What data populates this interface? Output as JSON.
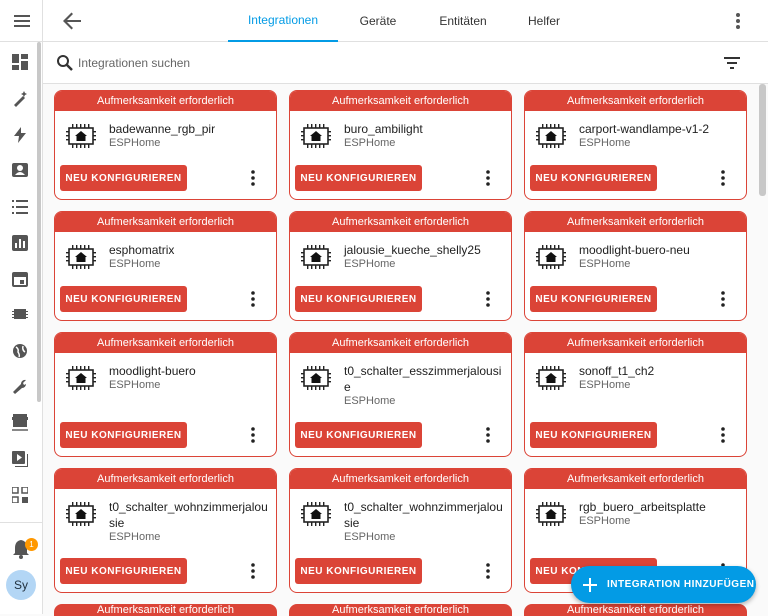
{
  "topbar": {
    "tabs": [
      "Integrationen",
      "Geräte",
      "Entitäten",
      "Helfer"
    ],
    "active_tab": "Integrationen"
  },
  "search": {
    "placeholder": "Integrationen suchen"
  },
  "notifications": {
    "count": "1"
  },
  "user": {
    "initials": "Sy"
  },
  "cards": [
    {
      "header": "Aufmerksamkeit erforderlich",
      "title": "badewanne_rgb_pir",
      "subtitle": "ESPHome",
      "button": "NEU KONFIGURIEREN"
    },
    {
      "header": "Aufmerksamkeit erforderlich",
      "title": "buro_ambilight",
      "subtitle": "ESPHome",
      "button": "NEU KONFIGURIEREN"
    },
    {
      "header": "Aufmerksamkeit erforderlich",
      "title": "carport-wandlampe-v1-2",
      "subtitle": "ESPHome",
      "button": "NEU KONFIGURIEREN"
    },
    {
      "header": "Aufmerksamkeit erforderlich",
      "title": "esphomatrix",
      "subtitle": "ESPHome",
      "button": "NEU KONFIGURIEREN"
    },
    {
      "header": "Aufmerksamkeit erforderlich",
      "title": "jalousie_kueche_shelly25",
      "subtitle": "ESPHome",
      "button": "NEU KONFIGURIEREN"
    },
    {
      "header": "Aufmerksamkeit erforderlich",
      "title": "moodlight-buero-neu",
      "subtitle": "ESPHome",
      "button": "NEU KONFIGURIEREN"
    },
    {
      "header": "Aufmerksamkeit erforderlich",
      "title": "moodlight-buero",
      "subtitle": "ESPHome",
      "button": "NEU KONFIGURIEREN"
    },
    {
      "header": "Aufmerksamkeit erforderlich",
      "title": "t0_schalter_esszimmerjalousie",
      "subtitle": "ESPHome",
      "button": "NEU KONFIGURIEREN"
    },
    {
      "header": "Aufmerksamkeit erforderlich",
      "title": "sonoff_t1_ch2",
      "subtitle": "ESPHome",
      "button": "NEU KONFIGURIEREN"
    },
    {
      "header": "Aufmerksamkeit erforderlich",
      "title": "t0_schalter_wohnzimmerjalousie",
      "subtitle": "ESPHome",
      "button": "NEU KONFIGURIEREN"
    },
    {
      "header": "Aufmerksamkeit erforderlich",
      "title": "t0_schalter_wohnzimmerjalousie",
      "subtitle": "ESPHome",
      "button": "NEU KONFIGURIEREN"
    },
    {
      "header": "Aufmerksamkeit erforderlich",
      "title": "rgb_buero_arbeitsplatte",
      "subtitle": "ESPHome",
      "button": "NEU KONFIGURIEREN"
    }
  ],
  "peek_header": "Aufmerksamkeit erforderlich",
  "fab": {
    "label": "INTEGRATION HINZUFÜGEN"
  },
  "colors": {
    "accent": "#039be5",
    "error": "#db4437",
    "badge": "#ff9800"
  }
}
